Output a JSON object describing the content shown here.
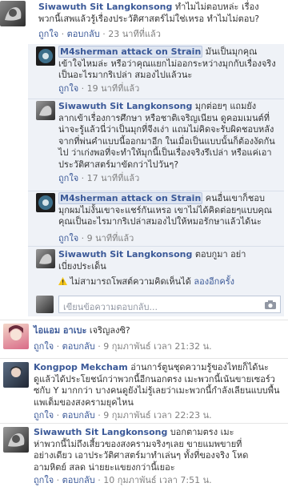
{
  "comments": [
    {
      "author": "Siwawuth Sit Langkonsong",
      "text1": "ทำไมไม่ตอบหล่ะ เรื่อง",
      "text2": "พวกนี้เสพแล้วรู้เรื่องประวัติศาสตร์ไม่ใช่เหรอ ทำไมไม่ตอบ?",
      "like": "ถูกใจ",
      "reply": "ตอบกลับ",
      "time": "23 นาทีที่แล้ว"
    }
  ],
  "replies": [
    {
      "author": "M4sherman attack on Strain",
      "lines": [
        "มันเป็นมุกคุณ",
        "เข้าใจไหมล่ะ หรือว่าคุณแยกไม่ออกระหว่างมุกกับเรื่องจริง",
        "เป็นอะไรมากริเปล่า สมองไปแล้วนะ"
      ],
      "like": "ถูกใจ",
      "time": "19 นาทีที่แล้ว"
    },
    {
      "author": "Siwawuth Sit Langkonsong",
      "lines": [
        "มุกต่อยๆ แถมยัง",
        "ลากเข้าเรื่องการศึกษา หรือชาติเจริญเนียน ดูคอมเมนต์ที่",
        "น่าจะรู้แล้วนี่ว่าเป็นมุกที่จีงเง่า แถมไม่คิดจะรับผิดชอบหลัง",
        "จากที่พ่นคำแบบนี้ออกมาอีก ในเมื่อเป็นแบบนั้นก็ต้องงัดกัน",
        "ไป ว่าเก่งพอที่จะทำให้มุกนี้เป็นเรื่องจริงรึเปล่า หรือแค่เอา",
        "ประวัติศาสตร์มาขัดกว่าไปวันๆ?"
      ],
      "like": "ถูกใจ",
      "time": "17 นาทีที่แล้ว"
    },
    {
      "author": "M4sherman attack on Strain",
      "lines": [
        "คนอื่นเขาก็ชอบ",
        "มุกผมไม่งั้นเขาจะแชร์กันเหรอ เขาไม่ได้คิดต่อยๆแบบคุณ",
        "คุณเป็นอะไรมากริเปล่าสมองไปให้หมอรักษาแล้วได้นะ"
      ],
      "like": "ถูกใจ",
      "time": "9 นาทีที่แล้ว"
    }
  ],
  "draft": {
    "author": "Siwawuth Sit Langkonsong",
    "text1": "ตอบกูมา อย่า",
    "text2": "เบี่ยงประเด็น",
    "error": "ไม่สามารถโพสต์ความคิดเห็นได้",
    "retry": "ลองอีกครั้ง"
  },
  "reply_input": {
    "placeholder": "เขียนข้อความตอบกลับ..."
  },
  "bottom_comments": [
    {
      "author": "ไอแอม อาเบะ",
      "text": "เจริญลงซิ?",
      "like": "ถูกใจ",
      "reply": "ตอบกลับ",
      "time": "9 กุมภาพันธ์ เวลา 21:32 น."
    },
    {
      "author": "Kongpop Mekcham",
      "lines": [
        "อ่านการ์ตูนชุดความรู้ของไทยก็ได้นะ",
        "ดูแล้วได้ประโยชน์กว่าพวกนี้อีกนอกตรง เมะพวกนี้เน้นขายเซอร์ว",
        "ซกับ Y มากกว่า บางคนดูยังไม่รู้เลยว่าเมะพวกนี้กำลังเลียนแบบพื้น",
        "แพเต็มของสงครามยุคไหน"
      ],
      "like": "ถูกใจ",
      "reply": "ตอบกลับ",
      "time": "9 กุมภาพันธ์ เวลา 22:23 น."
    },
    {
      "author": "Siwawuth Sit Langkonsong",
      "lines": [
        "บอกตามตรง เมะ",
        "ห่าพวกนี้ไม่ถึงเสี้ยวของสงครามจริงๆเลย ขายแมพขายที่",
        "อย่างเดียว เอาประวัติศาสตร์มาทำเล่นๆ ทั้งที่ของจริง โหด",
        "อามหิตย์ สลด น่ายยะแขยงกว่านี้เยอะ"
      ],
      "like": "ถูกใจ",
      "reply": "ตอบกลับ",
      "time": "10 กุมภาพันธ์ เวลา 7:51 น."
    }
  ],
  "colors": {
    "link": "#3b5998",
    "reply_bg": "#eff2f7",
    "error_icon": "#f5c518"
  }
}
